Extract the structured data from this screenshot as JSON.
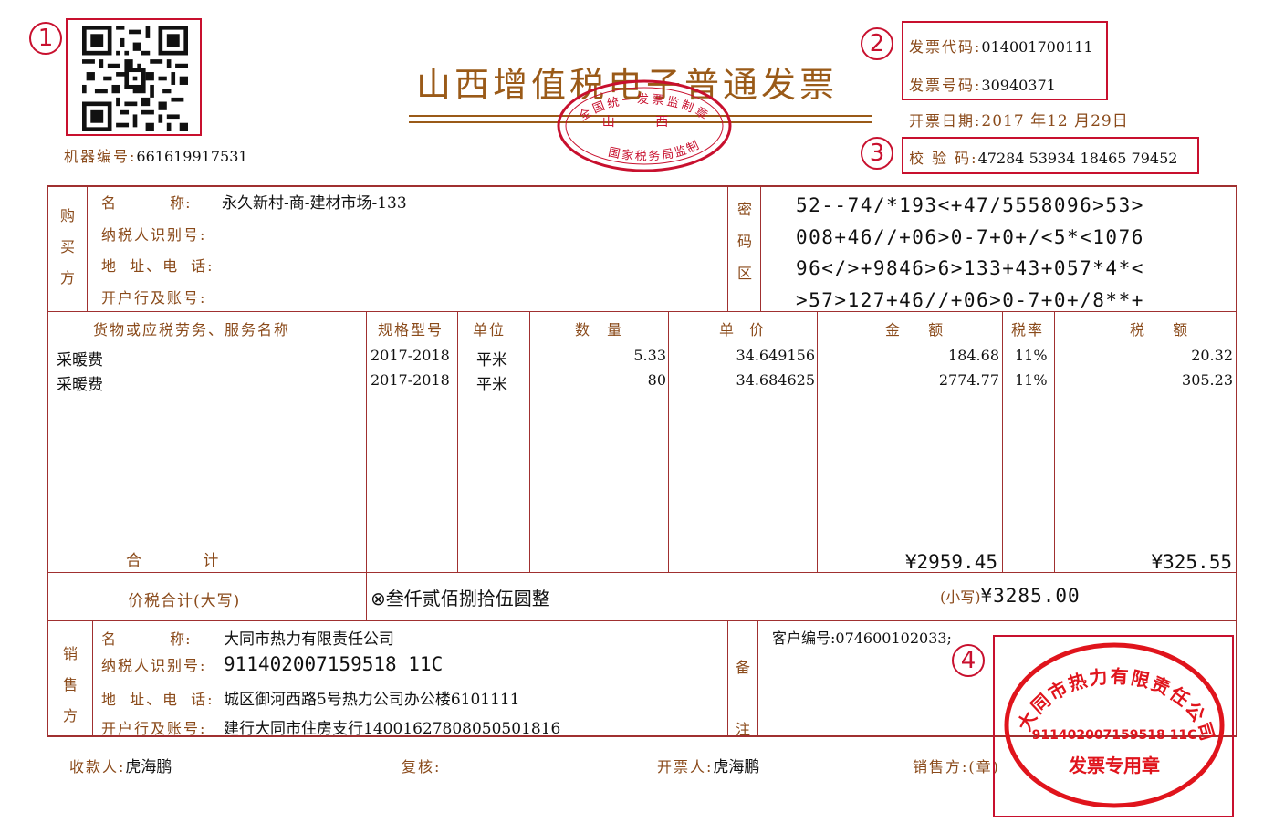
{
  "title": "山西增值税电子普通发票",
  "markers": [
    "1",
    "2",
    "3",
    "4"
  ],
  "header": {
    "machine_no_label": "机器编号:",
    "machine_no": "661619917531",
    "invoice_code_label": "发票代码:",
    "invoice_code": "014001700111",
    "invoice_no_label": "发票号码:",
    "invoice_no": "30940371",
    "date_label": "开票日期:",
    "date": "2017 年12 月29日",
    "check_code_label": "校 验 码:",
    "check_code": "47284 53934 18465 79452"
  },
  "tax_seal": {
    "top": "全国统一发票监制章",
    "middle": "山 西",
    "bottom": "国家税务局监制"
  },
  "buyer": {
    "section_label": [
      "购",
      "买",
      "方"
    ],
    "name_label": "名 称:",
    "name": "永久新村-商-建材市场-133",
    "taxid_label": "纳税人识别号:",
    "addr_label": "地 址、电 话:",
    "bank_label": "开户行及账号:"
  },
  "cipher": {
    "section_label": [
      "密",
      "码",
      "区"
    ],
    "lines": [
      "52--74/*193<+47/5558096>53>",
      "008+46//+06>0-7+0+/<5*<1076",
      "96</>+9846>6>133+43+057*4*<",
      ">57>127+46//+06>0-7+0+/8**+"
    ]
  },
  "items_table": {
    "headers": [
      "货物或应税劳务、服务名称",
      "规格型号",
      "单位",
      "数 量",
      "单 价",
      "金 额",
      "税率",
      "税 额"
    ],
    "rows": [
      {
        "name": "采暖费",
        "spec": "2017-2018",
        "unit": "平米",
        "qty": "5.33",
        "price": "34.649156",
        "amount": "184.68",
        "rate": "11%",
        "tax": "20.32"
      },
      {
        "name": "采暖费",
        "spec": "2017-2018",
        "unit": "平米",
        "qty": "80",
        "price": "34.684625",
        "amount": "2774.77",
        "rate": "11%",
        "tax": "305.23"
      }
    ],
    "total_label": "合 计",
    "total_amount": "¥2959.45",
    "total_tax": "¥325.55"
  },
  "grand_total": {
    "label": "价税合计(大写)",
    "symbol": "⊗",
    "words": "叁仟贰佰捌拾伍圆整",
    "small_label": "(小写)",
    "small_value": "¥3285.00"
  },
  "seller": {
    "section_label": [
      "销",
      "售",
      "方"
    ],
    "name_label": "名 称:",
    "name": "大同市热力有限责任公司",
    "taxid_label": "纳税人识别号:",
    "taxid": "911402007159518 11C",
    "addr_label": "地 址、电 话:",
    "addr": "城区御河西路5号热力公司办公楼6101111",
    "bank_label": "开户行及账号:",
    "bank": "建行大同市住房支行14001627808050501816"
  },
  "remarks": {
    "section_label": [
      "备",
      "注"
    ],
    "text": "客户编号:074600102033;"
  },
  "footer": {
    "payee_label": "收款人:",
    "payee": "虎海鹏",
    "reviewer_label": "复核:",
    "drawer_label": "开票人:",
    "drawer": "虎海鹏",
    "seller_label": "销售方:(章)"
  },
  "company_seal": {
    "name": "大同市热力有限责任公司",
    "taxid": "911402007159518 11C",
    "purpose": "发票专用章"
  },
  "colors": {
    "label": "#8a4a1a",
    "line": "#a03030",
    "annotation": "#c8102e",
    "value": "#111111"
  }
}
